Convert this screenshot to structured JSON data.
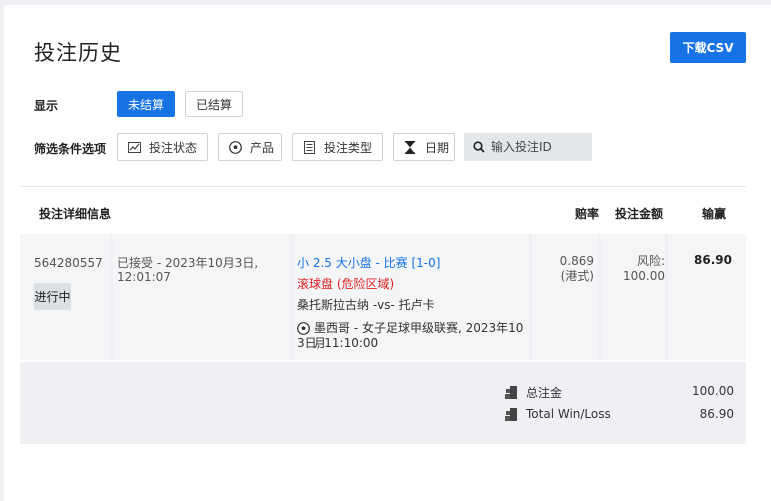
{
  "header": {
    "title": "投注历史",
    "download_label": "下载CSV"
  },
  "display": {
    "label": "显示",
    "tabs": [
      "未结算",
      "已结算"
    ]
  },
  "filters": {
    "label": "筛选条件选项",
    "items": [
      {
        "label": "投注状态",
        "icon": "trend-chart-icon"
      },
      {
        "label": "产品",
        "icon": "soccer-ball-icon"
      },
      {
        "label": "投注类型",
        "icon": "document-icon"
      },
      {
        "label": "日期",
        "icon": "hourglass-icon"
      }
    ],
    "search_placeholder": "输入投注ID"
  },
  "table": {
    "headers": {
      "details": "投注详细信息",
      "odds": "赔率",
      "stake": "投注金额",
      "winloss": "输赢"
    },
    "row": {
      "bet_id": "564280557",
      "status": "进行中",
      "accepted_line1": "已接受 - 2023年10月3日,",
      "accepted_line2": "12:01:07",
      "selection": "小 2.5 大小盘 - 比赛 [1-0]",
      "live_tag": "滚球盘 (危险区域)",
      "match": "桑托斯拉古纳 -vs- 托卢卡",
      "league_line1": "墨西哥 - 女子足球甲级联赛, 2023年10月",
      "league_line2": "3日, 11:10:00",
      "odds_value": "0.869",
      "odds_type": "(港式)",
      "stake_label": "风险:",
      "stake_value": "100.00",
      "winloss_value": "86.90"
    }
  },
  "summary": {
    "total_stake_label": "总注金",
    "total_stake_value": "100.00",
    "total_winloss_label": "Total Win/Loss",
    "total_winloss_value": "86.90"
  },
  "colors": {
    "accent": "#1673e6",
    "danger": "#e02020"
  }
}
